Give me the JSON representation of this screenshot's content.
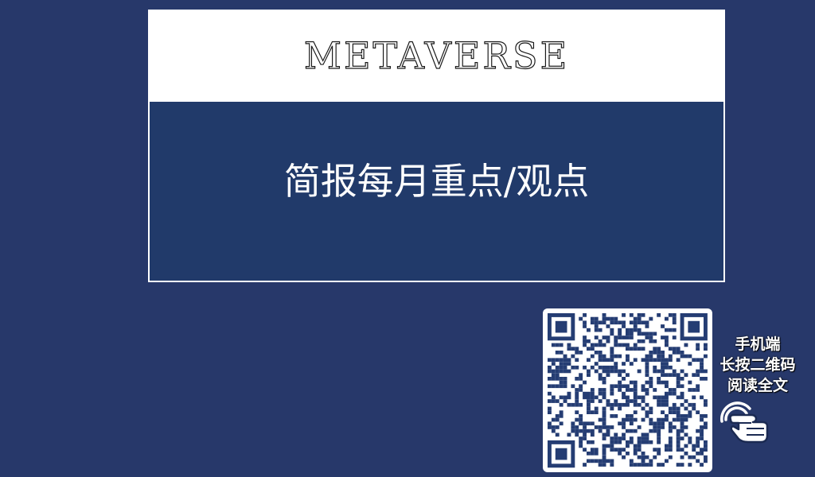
{
  "card": {
    "title": "METAVERSE",
    "subtitle": "简报每月重点/观点"
  },
  "qr": {
    "icon": "qr-code-icon",
    "label_lines": [
      "手机端",
      "长按二维码",
      "阅读全文"
    ]
  },
  "hand": {
    "icon": "tap-hand-icon"
  },
  "colors": {
    "background": "#27386a",
    "card_body": "#213a6a",
    "card_header": "#ffffff",
    "qr_dark": "#253d73"
  }
}
